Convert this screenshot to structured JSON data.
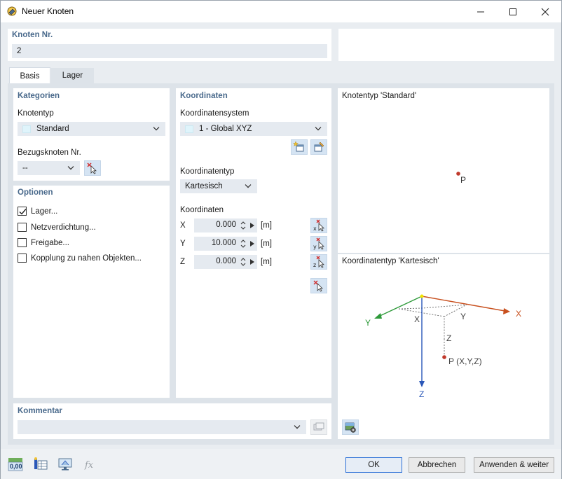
{
  "window": {
    "title": "Neuer Knoten"
  },
  "header": {
    "node_no_label": "Knoten Nr.",
    "node_no_value": "2"
  },
  "tabs": [
    {
      "label": "Basis"
    },
    {
      "label": "Lager"
    }
  ],
  "categories": {
    "title": "Kategorien",
    "node_type_label": "Knotentyp",
    "node_type_value": "Standard",
    "ref_node_label": "Bezugsknoten Nr.",
    "ref_node_value": "--"
  },
  "options": {
    "title": "Optionen",
    "items": [
      {
        "label": "Lager...",
        "checked": true
      },
      {
        "label": "Netzverdichtung...",
        "checked": false
      },
      {
        "label": "Freigabe...",
        "checked": false
      },
      {
        "label": "Kopplung zu nahen Objekten...",
        "checked": false
      }
    ]
  },
  "coordinates": {
    "title": "Koordinaten",
    "system_label": "Koordinatensystem",
    "system_value": "1 - Global XYZ",
    "type_label": "Koordinatentyp",
    "type_value": "Kartesisch",
    "coords_label": "Koordinaten",
    "rows": [
      {
        "axis": "X",
        "value": "0.000",
        "unit": "[m]"
      },
      {
        "axis": "Y",
        "value": "10.000",
        "unit": "[m]"
      },
      {
        "axis": "Z",
        "value": "0.000",
        "unit": "[m]"
      }
    ]
  },
  "preview": {
    "node_type_caption": "Knotentyp 'Standard'",
    "point_label": "P",
    "coord_type_caption": "Koordinatentyp 'Kartesisch'",
    "axes": {
      "x": "X",
      "y": "Y",
      "z": "Z"
    },
    "point_coords_label": "P (X,Y,Z)"
  },
  "comment": {
    "title": "Kommentar",
    "value": ""
  },
  "footer": {
    "ok": "OK",
    "cancel": "Abbrechen",
    "apply_next": "Anwenden & weiter",
    "units_icon_text": "0,00"
  },
  "colors": {
    "x_axis": "#c8501e",
    "y_axis": "#2e9a3a",
    "z_axis": "#2a57b8",
    "point": "#c0392b",
    "section_title": "#4a6a8c",
    "accent_button": "#2a6fd6"
  }
}
